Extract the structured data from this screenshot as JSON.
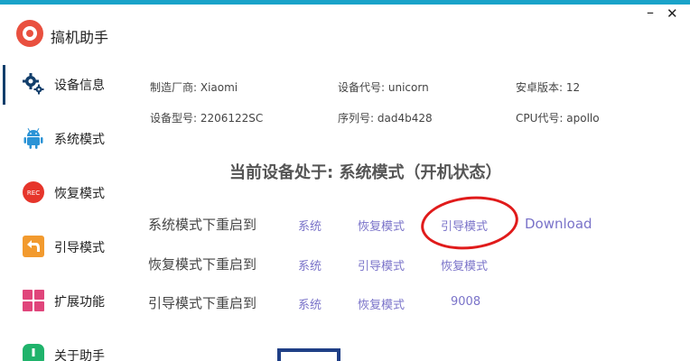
{
  "app": {
    "title": "搞机助手"
  },
  "window": {
    "minimize": "–",
    "close": "✕"
  },
  "sidebar": {
    "items": [
      {
        "label": "设备信息",
        "icon": "gear-icon"
      },
      {
        "label": "系统模式",
        "icon": "android-icon"
      },
      {
        "label": "恢复模式",
        "icon": "rec-icon",
        "icon_text": "REC"
      },
      {
        "label": "引导模式",
        "icon": "back-arrow-icon"
      },
      {
        "label": "扩展功能",
        "icon": "grid-icon"
      },
      {
        "label": "关于助手",
        "icon": "info-icon"
      }
    ]
  },
  "device": {
    "manufacturer": "制造厂商: Xiaomi",
    "codename": "设备代号: unicorn",
    "android_version": "安卓版本: 12",
    "model": "设备型号: 2206122SC",
    "serial": "序列号: dad4b428",
    "cpu": "CPU代号: apollo"
  },
  "status": {
    "text": "当前设备处于: 系统模式（开机状态）"
  },
  "reboot": {
    "rows": [
      {
        "label": "系统模式下重启到",
        "options": [
          "系统",
          "恢复模式",
          "引导模式",
          "Download"
        ]
      },
      {
        "label": "恢复模式下重启到",
        "options": [
          "系统",
          "引导模式",
          "恢复模式"
        ]
      },
      {
        "label": "引导模式下重启到",
        "options": [
          "系统",
          "恢复模式",
          "9008"
        ]
      }
    ]
  },
  "colors": {
    "accent": "#1aa3c9",
    "link": "#7a73c9",
    "annotation": "#e01b1b",
    "nav_active": "#123e6b"
  }
}
